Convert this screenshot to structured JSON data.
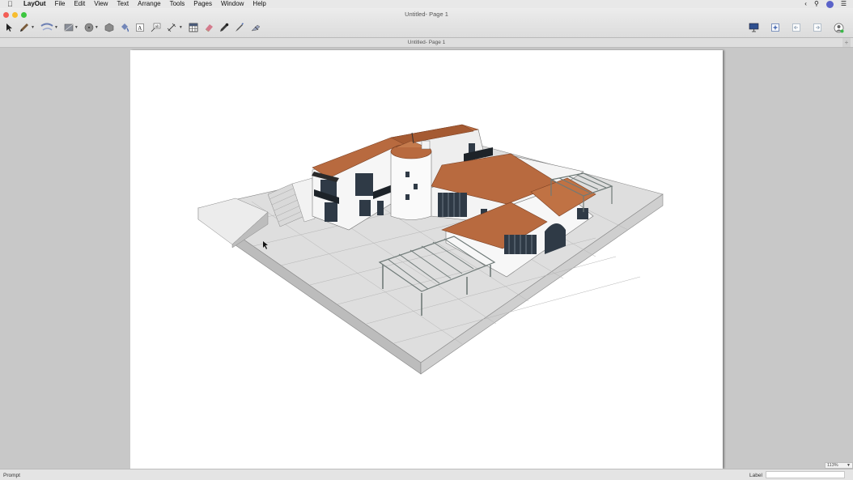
{
  "menubar": {
    "app_name": "LayOut",
    "menus": [
      "File",
      "Edit",
      "View",
      "Text",
      "Arrange",
      "Tools",
      "Pages",
      "Window",
      "Help"
    ]
  },
  "window": {
    "title": "Untitled- Page 1",
    "document_tab": "Untitled- Page 1"
  },
  "toolbar": {
    "tools": [
      "select-icon",
      "pencil-icon",
      "arc-icon",
      "rectangle-icon",
      "circle-icon",
      "polygon-icon",
      "paint-bucket-icon",
      "text-icon",
      "label-icon",
      "dimension-icon",
      "table-icon",
      "eraser-icon",
      "eyedropper-icon",
      "style-icon",
      "split-icon"
    ],
    "right_tools": [
      "presentation-icon",
      "add-page-icon",
      "previous-page-icon",
      "next-page-icon",
      "account-icon"
    ]
  },
  "statusbar": {
    "prompt": "Prompt",
    "label_caption": "Label",
    "label_value": ""
  },
  "zoom": {
    "value": "113%"
  },
  "colors": {
    "roof": "#b86a3f",
    "wall": "#f4f4f4",
    "ground": "#dddddd",
    "pergola": "#8c9694",
    "canvas_bg": "#c8c8c8"
  }
}
